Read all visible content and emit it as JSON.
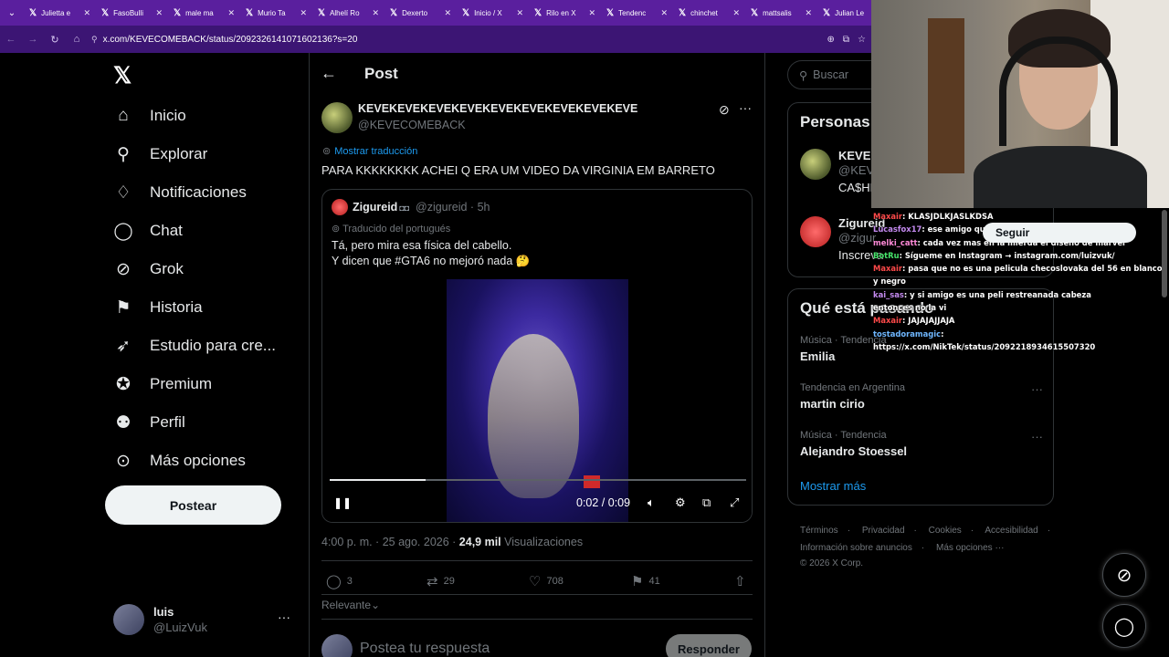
{
  "browser": {
    "tabs": [
      "Julietta e",
      "FasoBulli",
      "male ma",
      "Murio Ta",
      "Alhelí Ro",
      "Dexerto",
      "Inicio / X",
      "Rilo en X",
      "Tendenc",
      "chinchet",
      "mattsalis",
      "Julian Le"
    ],
    "url": "x.com/KEVECOMEBACK/status/2092326141071602136?s=20"
  },
  "nav": {
    "items": [
      {
        "label": "Inicio",
        "icon": "home-icon"
      },
      {
        "label": "Explorar",
        "icon": "search-icon"
      },
      {
        "label": "Notificaciones",
        "icon": "bell-icon"
      },
      {
        "label": "Chat",
        "icon": "chat-icon"
      },
      {
        "label": "Grok",
        "icon": "grok-icon"
      },
      {
        "label": "Historia",
        "icon": "bookmark-icon"
      },
      {
        "label": "Estudio para cre...",
        "icon": "rocket-icon"
      },
      {
        "label": "Premium",
        "icon": "verified-icon"
      },
      {
        "label": "Perfil",
        "icon": "person-icon"
      },
      {
        "label": "Más opciones",
        "icon": "more-circle-icon"
      }
    ],
    "post_button": "Postear",
    "account": {
      "name": "luis",
      "handle": "@LuizVuk"
    }
  },
  "post": {
    "header_title": "Post",
    "author_name": "KEVEKEVEKEVEKEVEKEVEKEVEKEVEKEVEKEVE",
    "author_handle": "@KEVECOMEBACK",
    "translate_link": "Mostrar traducción",
    "text": "PARA KKKKKKKK ACHEI Q ERA UM VIDEO DA VIRGINIA EM BARRETO",
    "quote": {
      "name": "Zigureid",
      "handle_time": "@zigureid · 5h",
      "translated_from": "Traducido del portugués",
      "line1": "Tá, pero mira esa física del cabello.",
      "line2": "Y dicen que #GTA6 no mejoró nada 🤔",
      "video": {
        "time": "0:02 / 0:09",
        "progress": 0.23
      }
    },
    "timestamp": "4:00 p. m. · 25 ago. 2026 · ",
    "views_count": "24,9 mil",
    "views_label": " Visualizaciones",
    "actions": {
      "replies": "3",
      "reposts": "29",
      "likes": "708",
      "bookmarks": "41"
    },
    "sort_label": "Relevante",
    "reply_placeholder": "Postea tu respuesta",
    "reply_button": "Responder"
  },
  "sidebar": {
    "search_placeholder": "Buscar",
    "people_title": "Personas",
    "people": [
      {
        "name": "KEVEK",
        "handle": "@KEVE",
        "bio": "CA$HE"
      },
      {
        "name": "Zigureid",
        "handle": "@zigur",
        "bio": "Inscreva"
      }
    ],
    "follow_button": "Seguir",
    "trends_title": "Qué está pasando",
    "trends": [
      {
        "context": "Música · Tendencia",
        "name": "Emilia"
      },
      {
        "context": "Tendencia en Argentina",
        "name": "martin cirio"
      },
      {
        "context": "Música · Tendencia",
        "name": "Alejandro Stoessel"
      }
    ],
    "show_more": "Mostrar más",
    "footer": {
      "row1": [
        "Términos",
        "Privacidad",
        "Cookies",
        "Accesibilidad"
      ],
      "row2": [
        "Información sobre anuncios",
        "Más opciones ···"
      ],
      "copyright": "© 2026 X Corp."
    }
  },
  "chat": [
    {
      "user": "Maxair",
      "text": ": KLASJDLKJASLKDSA"
    },
    {
      "user": "Lucasfox17",
      "text": ": ese amigo que es diseñador grafico"
    },
    {
      "user": "melki_catt",
      "text": ": cada vez mas en la mierda el diseño de marvel"
    },
    {
      "user": "BotRu",
      "text": ": Sígueme en Instagram → instagram.com/luizvuk/"
    },
    {
      "user": "Maxair",
      "text": ": pasa que no es una pelicula checoslovaka del 56 en blanco y negro"
    },
    {
      "user": "kai_sas",
      "text": ": y si amigo es una peli restreanada cabeza"
    },
    {
      "user": "",
      "text": "entonces no la vi"
    },
    {
      "user": "Maxair",
      "text": ": JAJAJAJJAJA"
    },
    {
      "user": "tostadoramagic",
      "text": ":"
    },
    {
      "user": "",
      "text": "https://x.com/NikTek/status/2092218934615507320"
    }
  ]
}
